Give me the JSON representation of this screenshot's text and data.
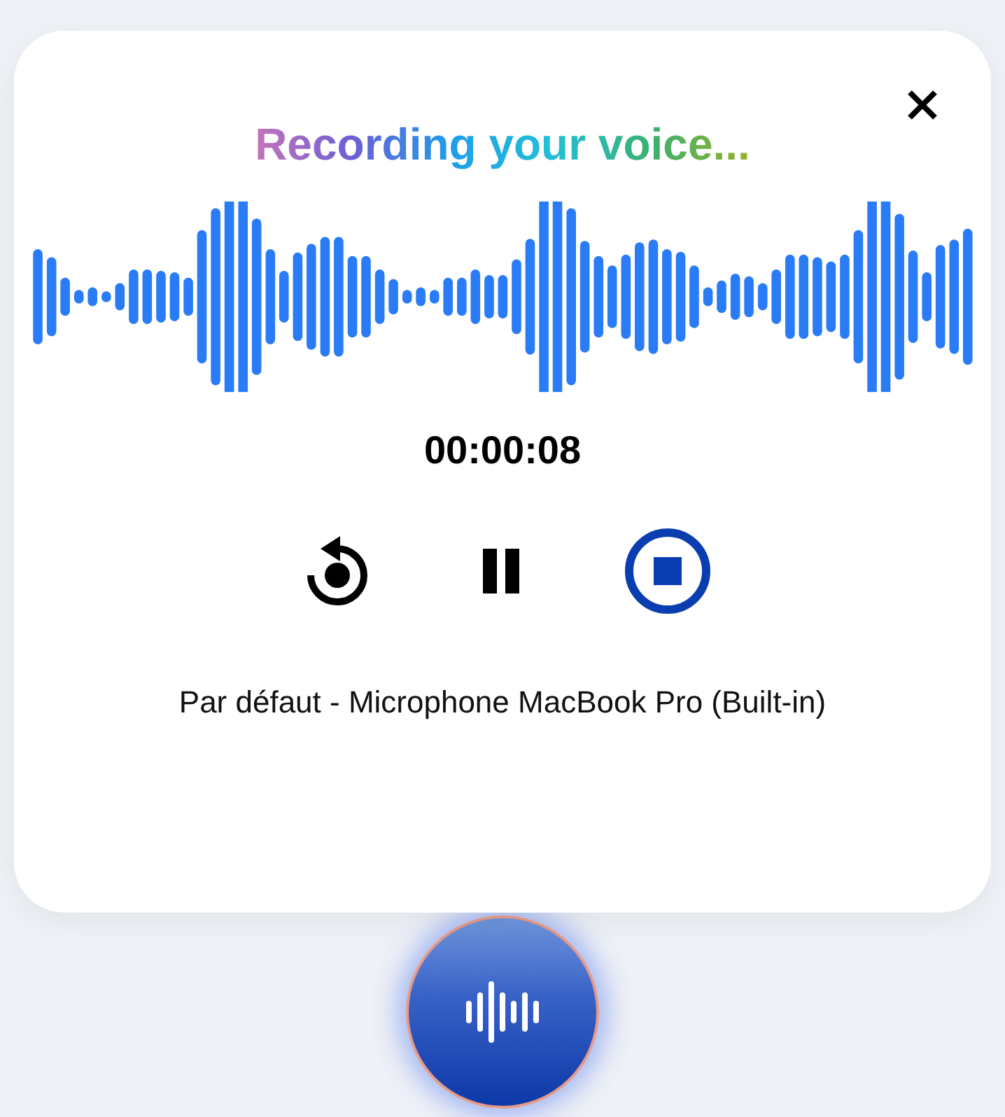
{
  "recorder": {
    "title": "Recording your voice...",
    "timer": "00:00:08",
    "device": "Par défaut - Microphone MacBook Pro (Built-in)"
  }
}
